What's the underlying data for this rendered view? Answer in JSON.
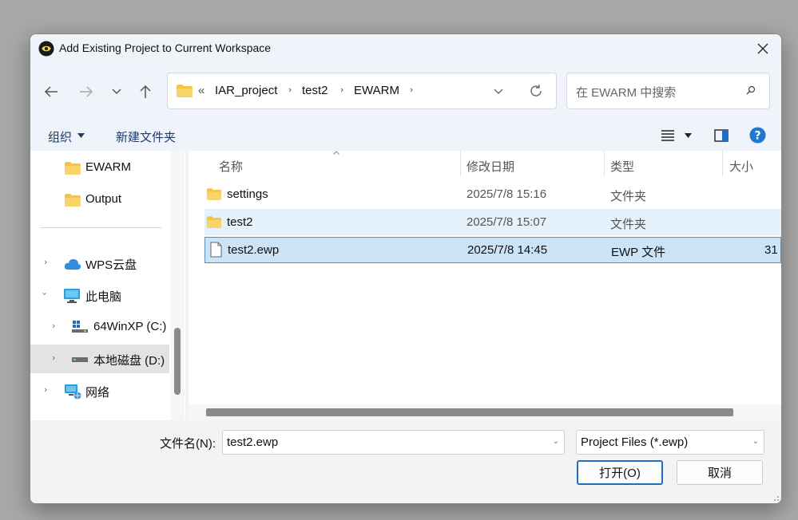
{
  "window": {
    "title": "Add Existing Project to Current Workspace"
  },
  "address": {
    "overflow": "«",
    "crumbs": [
      "IAR_project",
      "test2",
      "EWARM"
    ]
  },
  "search": {
    "placeholder": "在 EWARM 中搜索"
  },
  "toolbar": {
    "organize": "组织",
    "new_folder": "新建文件夹"
  },
  "sidebar": {
    "items": [
      {
        "label": "EWARM",
        "icon": "folder-icon"
      },
      {
        "label": "Output",
        "icon": "folder-icon"
      },
      {
        "label": "WPS云盘",
        "icon": "cloud-icon"
      },
      {
        "label": "此电脑",
        "icon": "computer-icon"
      },
      {
        "label": "64WinXP  (C:)",
        "icon": "windows-drive-icon"
      },
      {
        "label": "本地磁盘 (D:)",
        "icon": "drive-icon"
      },
      {
        "label": "网络",
        "icon": "network-icon"
      }
    ]
  },
  "columns": {
    "name": "名称",
    "modified": "修改日期",
    "type": "类型",
    "size": "大小"
  },
  "files": [
    {
      "name": "settings",
      "modified": "2025/7/8 15:16",
      "type": "文件夹",
      "size": "",
      "icon": "folder-icon"
    },
    {
      "name": "test2",
      "modified": "2025/7/8 15:07",
      "type": "文件夹",
      "size": "",
      "icon": "folder-icon"
    },
    {
      "name": "test2.ewp",
      "modified": "2025/7/8 14:45",
      "type": "EWP 文件",
      "size": "31",
      "icon": "file-icon"
    }
  ],
  "bottom": {
    "filename_label": "文件名(N):",
    "filename_value": "test2.ewp",
    "filter_value": "Project Files (*.ewp)",
    "open_label": "打开(O)",
    "cancel_label": "取消"
  },
  "colors": {
    "selection": "#cce4f7",
    "hover": "#e5f1fb",
    "accent": "#1f6fc1",
    "folder": "#f4c542"
  }
}
